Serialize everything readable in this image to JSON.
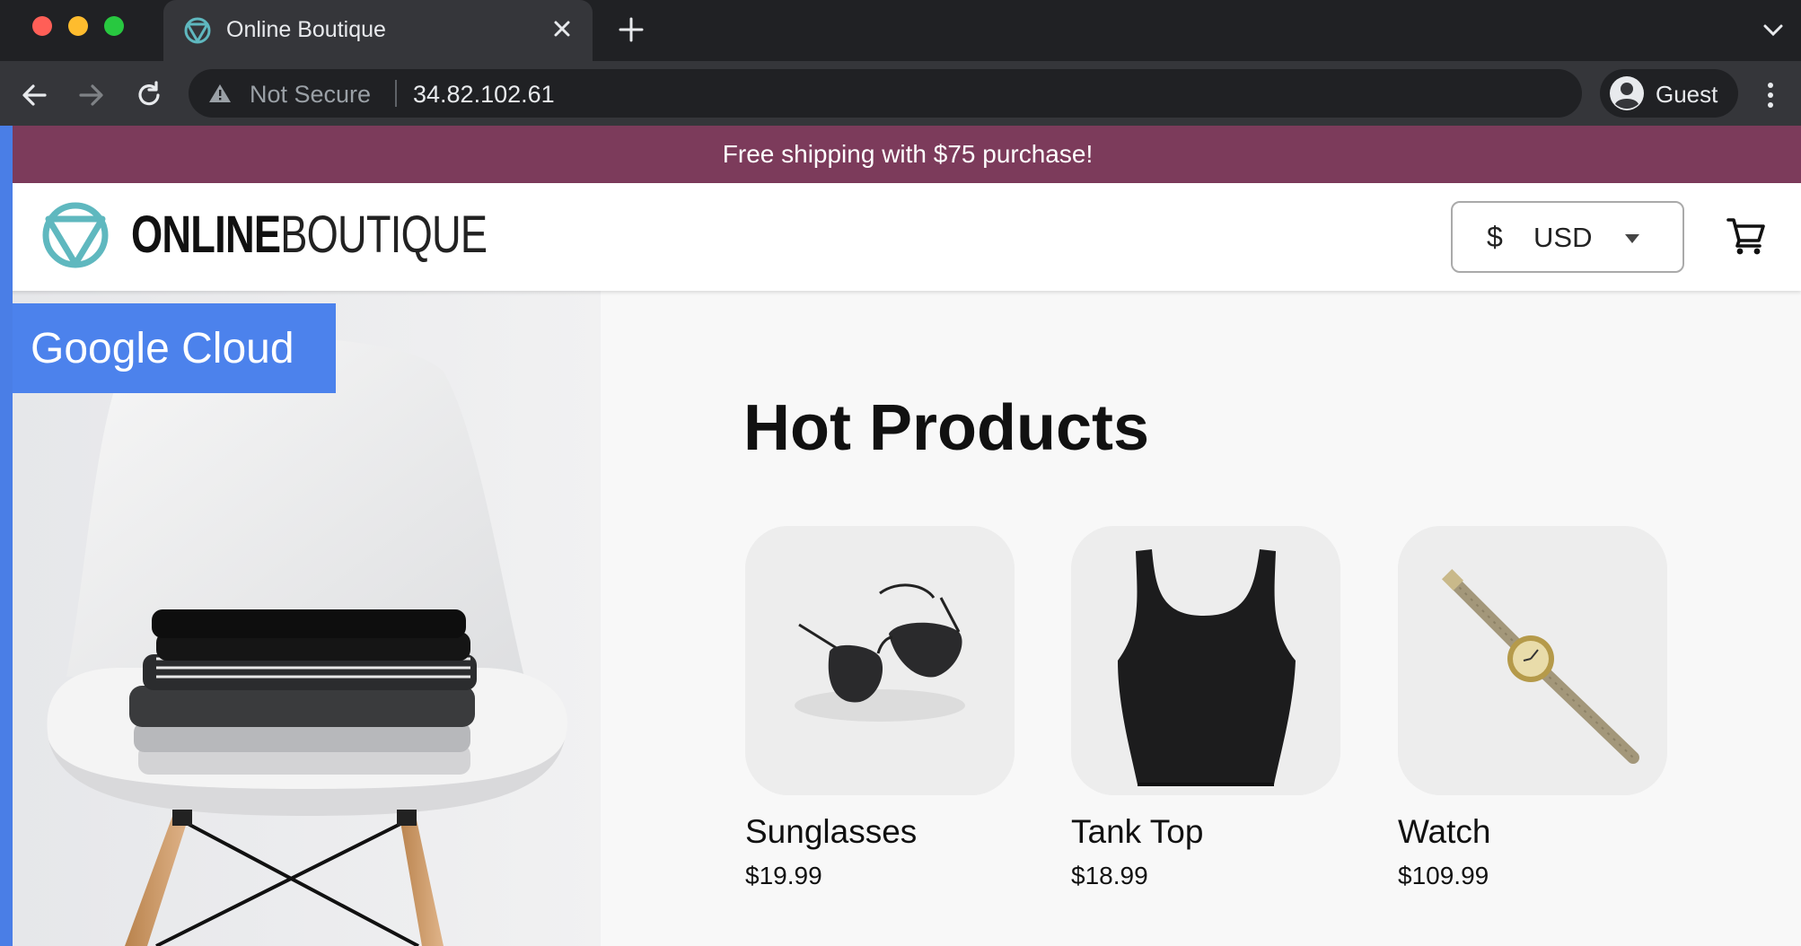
{
  "browser": {
    "tab_title": "Online Boutique",
    "security_label": "Not Secure",
    "url": "34.82.102.61",
    "profile_label": "Guest"
  },
  "banner": {
    "text": "Free shipping with $75 purchase!"
  },
  "header": {
    "logo_bold": "ONLINE",
    "logo_light": "BOUTIQUE",
    "currency_symbol": "$",
    "currency_code": "USD",
    "brand_color": "#5fb8bf"
  },
  "hero": {
    "badge_text": "Google Cloud"
  },
  "section": {
    "title": "Hot Products"
  },
  "products": [
    {
      "name": "Sunglasses",
      "price": "$19.99",
      "image": "sunglasses-image"
    },
    {
      "name": "Tank Top",
      "price": "$18.99",
      "image": "tank-top-image"
    },
    {
      "name": "Watch",
      "price": "$109.99",
      "image": "watch-image"
    }
  ],
  "colors": {
    "banner_bg": "#7c3b5b",
    "google_cloud_blue": "#4c82ec",
    "chrome_dark": "#202124",
    "chrome_toolbar": "#35363a"
  }
}
